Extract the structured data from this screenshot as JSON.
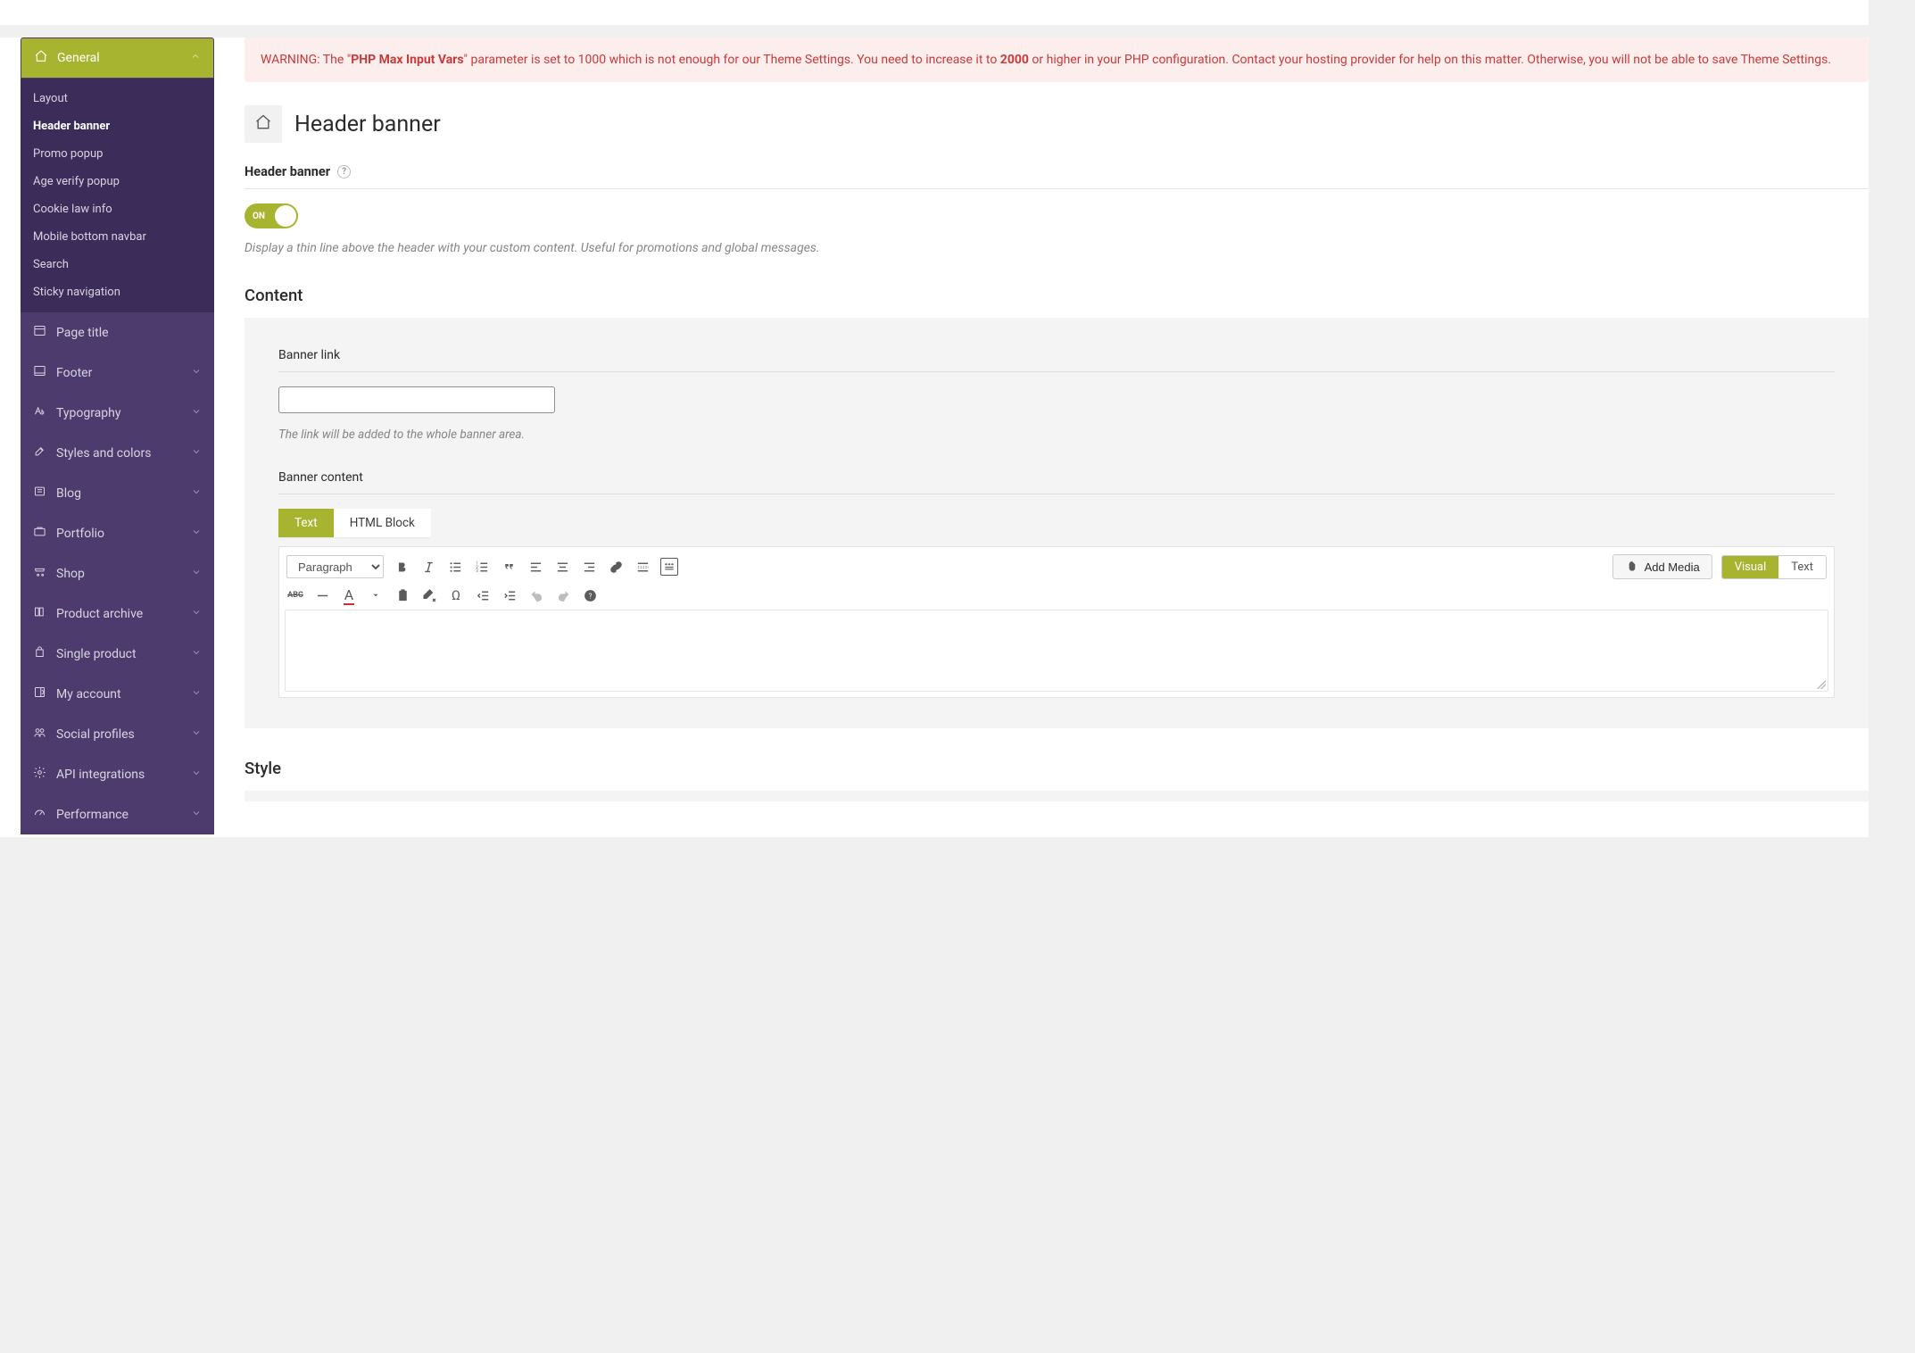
{
  "sidebar": {
    "active_section": "General",
    "general_subitems": [
      {
        "label": "Layout",
        "active": false
      },
      {
        "label": "Header banner",
        "active": true
      },
      {
        "label": "Promo popup",
        "active": false
      },
      {
        "label": "Age verify popup",
        "active": false
      },
      {
        "label": "Cookie law info",
        "active": false
      },
      {
        "label": "Mobile bottom navbar",
        "active": false
      },
      {
        "label": "Search",
        "active": false
      },
      {
        "label": "Sticky navigation",
        "active": false
      }
    ],
    "sections": {
      "page_title": "Page title",
      "footer": "Footer",
      "typography": "Typography",
      "styles_colors": "Styles and colors",
      "blog": "Blog",
      "portfolio": "Portfolio",
      "shop": "Shop",
      "product_archive": "Product archive",
      "single_product": "Single product",
      "my_account": "My account",
      "social_profiles": "Social profiles",
      "api_integrations": "API integrations",
      "performance": "Performance"
    }
  },
  "alert": {
    "prefix": "WARNING: The \"",
    "bold1": "PHP Max Input Vars",
    "mid1": "\" parameter is set to 1000 which is not enough for our Theme Settings. You need to increase it to ",
    "bold2": "2000",
    "mid2": " or higher in your PHP configuration. Contact your hosting provider for help on this matter. Otherwise, you will not be able to save Theme Settings."
  },
  "page": {
    "title": "Header banner"
  },
  "header_banner_field": {
    "label": "Header banner",
    "toggle_text": "ON",
    "description": "Display a thin line above the header with your custom content. Useful for promotions and global messages."
  },
  "content": {
    "title": "Content",
    "banner_link": {
      "label": "Banner link",
      "value": "",
      "description": "The link will be added to the whole banner area."
    },
    "banner_content": {
      "label": "Banner content",
      "tabs": {
        "text": "Text",
        "html_block": "HTML Block"
      },
      "format_select": "Paragraph",
      "add_media": "Add Media",
      "visual_text_tabs": {
        "visual": "Visual",
        "text": "Text"
      },
      "toolbar_row2_abc": "ABC",
      "toolbar_row2_a": "A",
      "toolbar_row2_omega": "Ω"
    }
  },
  "style": {
    "title": "Style"
  },
  "colors": {
    "accent": "#a6b430",
    "sidebar_bg": "#4e3b6e",
    "sidebar_dark": "#3c2c5a",
    "alert_bg": "#fdeeee",
    "alert_text": "#c93a3a"
  }
}
